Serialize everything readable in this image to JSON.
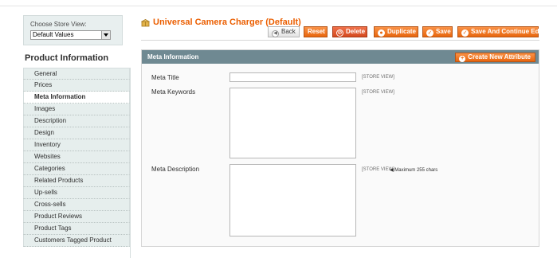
{
  "store_switcher": {
    "label": "Choose Store View:",
    "selected": "Default Values"
  },
  "sidebar": {
    "title": "Product Information",
    "items": [
      {
        "label": "General"
      },
      {
        "label": "Prices"
      },
      {
        "label": "Meta Information"
      },
      {
        "label": "Images"
      },
      {
        "label": "Description"
      },
      {
        "label": "Design"
      },
      {
        "label": "Inventory"
      },
      {
        "label": "Websites"
      },
      {
        "label": "Categories"
      },
      {
        "label": "Related Products"
      },
      {
        "label": "Up-sells"
      },
      {
        "label": "Cross-sells"
      },
      {
        "label": "Product Reviews"
      },
      {
        "label": "Product Tags"
      },
      {
        "label": "Customers Tagged Product"
      }
    ],
    "active_index": 2
  },
  "header": {
    "title": "Universal Camera Charger (Default)",
    "buttons": {
      "back": "Back",
      "reset": "Reset",
      "delete": "Delete",
      "duplicate": "Duplicate",
      "save": "Save",
      "save_continue": "Save And Continue Edit"
    }
  },
  "fieldset": {
    "title": "Meta Information",
    "create_attribute": "Create New Attribute",
    "fields": {
      "meta_title": {
        "label": "Meta Title",
        "value": "",
        "scope": "[STORE VIEW]"
      },
      "meta_keywords": {
        "label": "Meta Keywords",
        "value": "",
        "scope": "[STORE VIEW]"
      },
      "meta_description": {
        "label": "Meta Description",
        "value": "",
        "scope": "[STORE VIEW]",
        "note": "Maximum 255 chars"
      }
    }
  },
  "colors": {
    "accent": "#eb5e00",
    "button": "#e8660e",
    "fieldset_header": "#6f8992",
    "tab_bg": "#e6eeed"
  }
}
